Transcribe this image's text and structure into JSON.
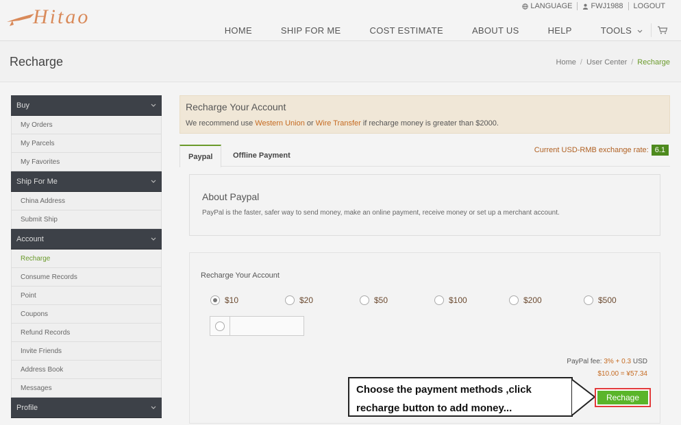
{
  "header": {
    "logo_text": "Hitao",
    "topbar": {
      "language": "LANGUAGE",
      "user": "FWJ1988",
      "logout": "LOGOUT"
    },
    "nav": [
      "HOME",
      "SHIP FOR ME",
      "COST ESTIMATE",
      "ABOUT US",
      "HELP",
      "TOOLS"
    ]
  },
  "page": {
    "title": "Recharge",
    "breadcrumb": [
      "Home",
      "User Center",
      "Recharge"
    ]
  },
  "sidebar": {
    "groups": [
      {
        "label": "Buy",
        "items": [
          "My Orders",
          "My Parcels",
          "My Favorites"
        ]
      },
      {
        "label": "Ship For Me",
        "items": [
          "China Address",
          "Submit Ship"
        ]
      },
      {
        "label": "Account",
        "items": [
          "Recharge",
          "Consume Records",
          "Point",
          "Coupons",
          "Refund Records",
          "Invite Friends",
          "Address Book",
          "Messages"
        ]
      },
      {
        "label": "Profile",
        "items": []
      }
    ]
  },
  "notice": {
    "title": "Recharge Your Account",
    "text_before": "We recommend use ",
    "link1": "Western Union",
    "text_mid": " or ",
    "link2": "Wire Transfer",
    "text_after": " if recharge money is greater than $2000."
  },
  "tabs": [
    "Paypal",
    "Offline Payment"
  ],
  "rate": {
    "label": "Current USD-RMB exchange rate:",
    "value": "6.1"
  },
  "about": {
    "title": "About Paypal",
    "text": "PayPal is the faster, safer way to send money, make an online payment, receive money or set up a merchant account."
  },
  "recharge": {
    "title": "Recharge Your Account",
    "amounts": [
      "$10",
      "$20",
      "$50",
      "$100",
      "$200",
      "$500"
    ],
    "selected": "$10",
    "custom_placeholder": "",
    "fee_label": "PayPal fee: ",
    "fee_value": "3% + 0.3",
    "fee_unit": " USD",
    "total": "$10.00  =  ¥57.34",
    "button": "Rechage"
  },
  "callout": {
    "line1": "Choose the payment methods ,click",
    "line2": "recharge button to add money..."
  },
  "colors": {
    "accent_green": "#6a9a2a",
    "sidebar_dark": "#3d4148",
    "link_orange": "#c56a20",
    "button_green": "#5ab52a",
    "highlight_red": "#e23a3a"
  }
}
